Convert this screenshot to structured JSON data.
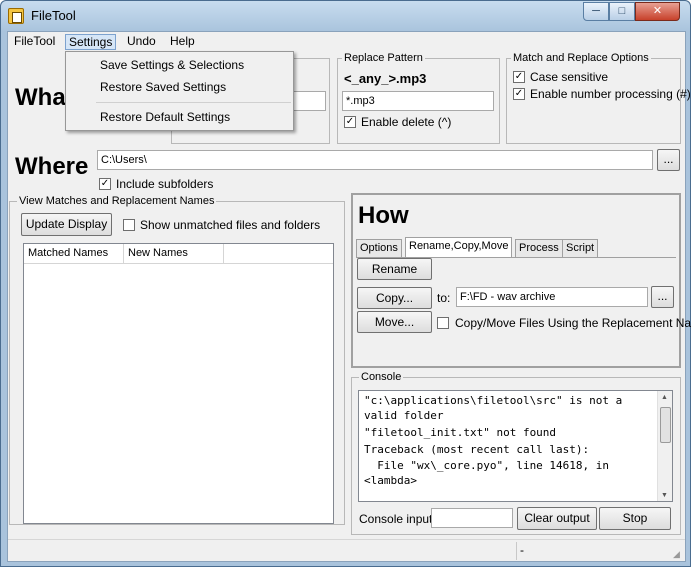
{
  "window": {
    "title": "FileTool"
  },
  "window_controls": {
    "minimize": "─",
    "maximize": "□",
    "close": "✕"
  },
  "menubar": {
    "items": [
      "FileTool",
      "Settings",
      "Undo",
      "Help"
    ]
  },
  "settings_menu": {
    "items": [
      "Save Settings & Selections",
      "Restore Saved Settings",
      "Restore Default Settings"
    ]
  },
  "what": {
    "heading": "What"
  },
  "replace_pattern": {
    "group_label": "Replace Pattern",
    "pattern_display": "<_any_>.mp3",
    "value": "*.mp3",
    "enable_delete_label": "Enable delete (^)",
    "enable_delete_checked": true
  },
  "match_options": {
    "group_label": "Match and Replace Options",
    "case_sensitive_label": "Case sensitive",
    "case_sensitive_checked": true,
    "number_processing_label": "Enable number processing (#)",
    "number_processing_checked": true
  },
  "where": {
    "heading": "Where",
    "path": "C:\\Users\\",
    "browse_label": "...",
    "include_subfolders_label": "Include subfolders",
    "include_subfolders_checked": true
  },
  "matches": {
    "group_label": "View Matches and Replacement Names",
    "update_button": "Update Display",
    "show_unmatched_label": "Show unmatched files and folders",
    "show_unmatched_checked": false,
    "columns": [
      "Matched Names",
      "New Names"
    ]
  },
  "how": {
    "heading": "How",
    "tabs": [
      "Options",
      "Rename,Copy,Move",
      "Process",
      "Script"
    ],
    "active_tab": "Rename,Copy,Move",
    "rename_button": "Rename",
    "copy_button": "Copy...",
    "move_button": "Move...",
    "to_label": "to:",
    "destination": "F:\\FD - wav archive",
    "browse_label": "...",
    "use_replacement_label": "Copy/Move Files Using the Replacement Name",
    "use_replacement_checked": false
  },
  "console": {
    "group_label": "Console",
    "lines": [
      "\"c:\\applications\\filetool\\src\" is not a",
      "valid folder",
      "\"filetool_init.txt\" not found",
      "Traceback (most recent call last):",
      "  File \"wx\\_core.pyo\", line 14618, in",
      "<lambda>"
    ],
    "input_label": "Console input:",
    "input_value": "",
    "clear_button": "Clear output",
    "stop_button": "Stop"
  },
  "statusbar": {
    "right_text": "-"
  },
  "colors": {
    "title_bar": "#aac4dd",
    "client_bg": "#f0f0f0",
    "close_button": "#c7412b"
  }
}
